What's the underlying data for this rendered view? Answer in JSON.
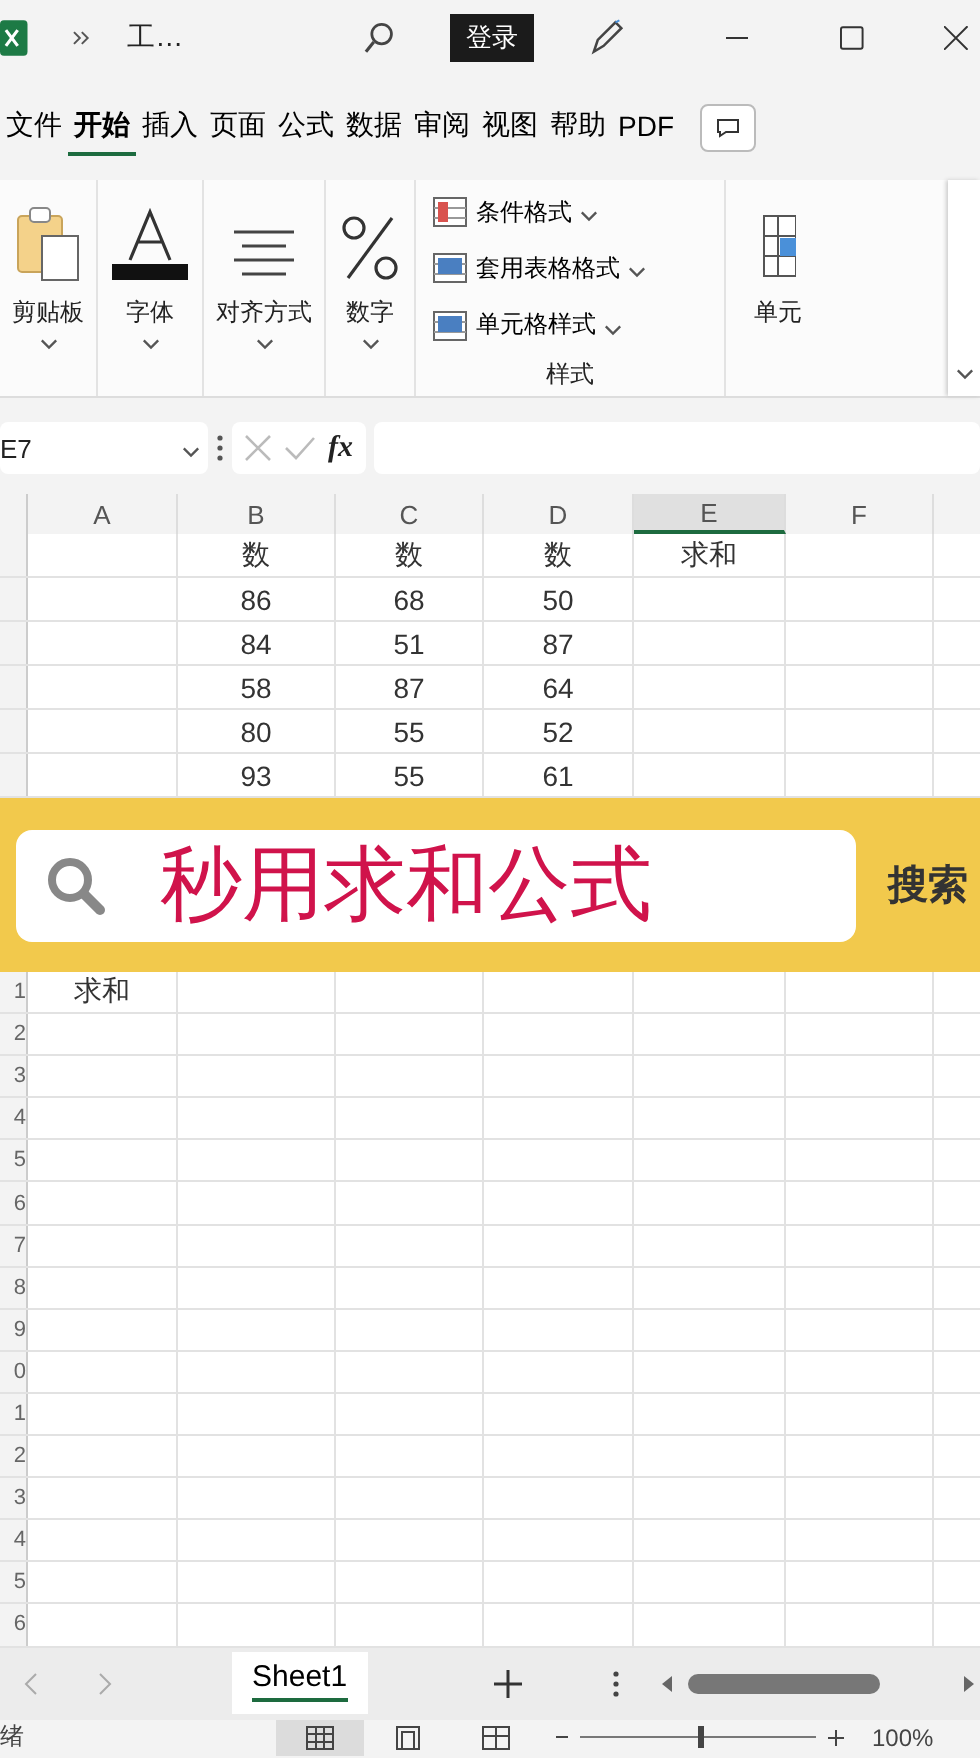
{
  "title_bar": {
    "title": "工…",
    "sign_in": "登录"
  },
  "ribbon_tabs": [
    {
      "label": "文件",
      "selected": false
    },
    {
      "label": "开始",
      "selected": true
    },
    {
      "label": "插入",
      "selected": false
    },
    {
      "label": "页面",
      "selected": false
    },
    {
      "label": "公式",
      "selected": false
    },
    {
      "label": "数据",
      "selected": false
    },
    {
      "label": "审阅",
      "selected": false
    },
    {
      "label": "视图",
      "selected": false
    },
    {
      "label": "帮助",
      "selected": false
    },
    {
      "label": "PDF",
      "selected": false
    }
  ],
  "ribbon_groups": [
    {
      "kind": "clipboard",
      "label": "剪贴板"
    },
    {
      "kind": "font",
      "label": "字体"
    },
    {
      "kind": "alignment",
      "label": "对齐方式"
    },
    {
      "kind": "number",
      "label": "数字"
    },
    {
      "kind": "styles",
      "label": "样式",
      "items": [
        "条件格式",
        "套用表格格式",
        "单元格样式"
      ]
    },
    {
      "kind": "cells",
      "label": "单元"
    }
  ],
  "formula_bar": {
    "name_box": "E7",
    "fx": "fx"
  },
  "columns": [
    {
      "label": "A",
      "selected": false
    },
    {
      "label": "B",
      "selected": false
    },
    {
      "label": "C",
      "selected": false
    },
    {
      "label": "D",
      "selected": false
    },
    {
      "label": "E",
      "selected": true
    },
    {
      "label": "F",
      "selected": false
    }
  ],
  "rows_top": [
    {
      "column_b": "数",
      "column_c": "数",
      "column_d": "数",
      "column_e": "求和"
    },
    {
      "column_b": "86",
      "column_c": "68",
      "column_d": "50"
    },
    {
      "column_b": "84",
      "column_c": "51",
      "column_d": "87"
    },
    {
      "column_b": "58",
      "column_c": "87",
      "column_d": "64"
    },
    {
      "column_b": "80",
      "column_c": "55",
      "column_d": "52"
    },
    {
      "column_b": "93",
      "column_c": "55",
      "column_d": "61"
    }
  ],
  "banner": {
    "text": "秒用求和公式",
    "button": "搜索"
  },
  "rows_bottom": [
    {
      "row": "1",
      "column_a": "求和"
    },
    {
      "row": "2"
    },
    {
      "row": "3"
    },
    {
      "row": "4"
    },
    {
      "row": "5"
    },
    {
      "row": "6"
    },
    {
      "row": "7"
    },
    {
      "row": "8"
    },
    {
      "row": "9"
    },
    {
      "row": "0"
    },
    {
      "row": "1"
    },
    {
      "row": "2"
    },
    {
      "row": "3"
    },
    {
      "row": "4"
    },
    {
      "row": "5"
    },
    {
      "row": "6"
    }
  ],
  "sheet_tabs": [
    {
      "label": "Sheet1",
      "selected": true
    }
  ],
  "status_bar": {
    "status": "绪",
    "zoom": "100%",
    "zoom_slider": {
      "level": 0.5
    },
    "views": [
      {
        "kind": "normal",
        "selected": true
      },
      {
        "kind": "page-layout",
        "selected": false
      },
      {
        "kind": "page-break",
        "selected": false
      }
    ]
  }
}
